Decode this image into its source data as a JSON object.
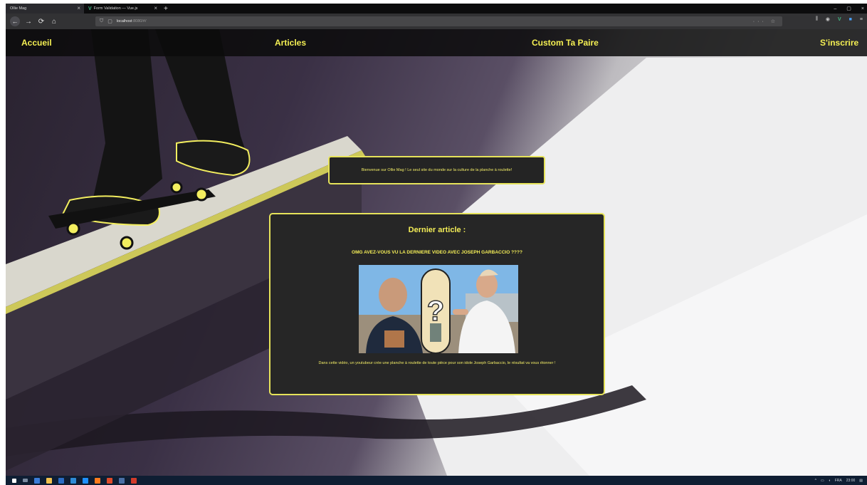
{
  "browser": {
    "tabs": [
      {
        "title": "Ollie Mag",
        "active": true
      },
      {
        "title": "Form Validation — Vue.js",
        "active": false
      }
    ],
    "new_tab": "+",
    "url_host": "localhost",
    "url_path": ":8080/#/",
    "window_controls": [
      "–",
      "▢",
      "×"
    ]
  },
  "site_nav": {
    "home": "Accueil",
    "articles": "Articles",
    "custom": "Custom Ta Paire",
    "signup": "S'inscrire"
  },
  "welcome_text": "Bienvenue sur Ollie Mag ! Le seul site du monde sur la culture de la planche à roulette!",
  "article": {
    "heading": "Dernier article :",
    "title": "OMG AVEZ-VOUS VU LA DERNIERE VIDEO AVEC JOSEPH GARBACCIO ????",
    "description": "Dans cette vidéo, un youtubeur crée une planche à roulette de toute pièce pour son idole Joseph Garbaccio, le résultat va vous étonner !"
  },
  "tray": {
    "lang": "FRA",
    "time": "23:00"
  },
  "colors": {
    "accent": "#f4ee57",
    "panel": "#262626",
    "nav_bg": "#0a0a0a"
  }
}
